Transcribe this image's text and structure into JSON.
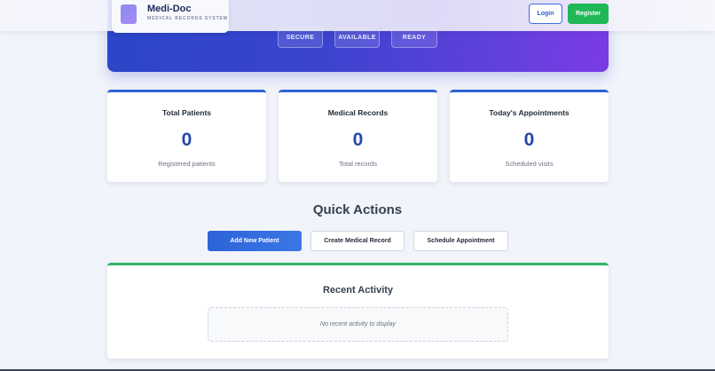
{
  "header": {
    "logo_title": "Medi-Doc",
    "logo_subtitle": "MEDICAL RECORDS SYSTEM",
    "login_label": "Login",
    "register_label": "Register"
  },
  "hero": {
    "badges": [
      "SECURE",
      "AVAILABLE",
      "READY"
    ]
  },
  "stats": [
    {
      "title": "Total Patients",
      "value": "0",
      "subtitle": "Registered patients"
    },
    {
      "title": "Medical Records",
      "value": "0",
      "subtitle": "Total records"
    },
    {
      "title": "Today's Appointments",
      "value": "0",
      "subtitle": "Scheduled visits"
    }
  ],
  "quick_actions": {
    "title": "Quick Actions",
    "buttons": [
      "Add New Patient",
      "Create Medical Record",
      "Schedule Appointment"
    ]
  },
  "recent_activity": {
    "title": "Recent Activity",
    "empty_text": "No recent activity to display"
  },
  "colors": {
    "primary": "#2f63d6",
    "success": "#20b757",
    "hero_start": "#2a46c8",
    "hero_end": "#7b3be6"
  }
}
